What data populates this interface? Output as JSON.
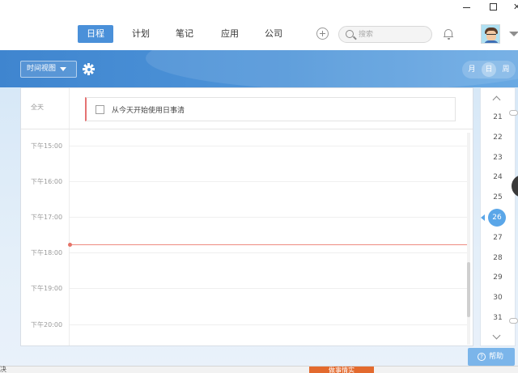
{
  "nav": {
    "tabs": [
      {
        "label": "日程",
        "active": true
      },
      {
        "label": "计划",
        "active": false
      },
      {
        "label": "笔记",
        "active": false
      },
      {
        "label": "应用",
        "active": false
      },
      {
        "label": "公司",
        "active": false
      }
    ]
  },
  "search": {
    "placeholder": "搜索"
  },
  "toolbar": {
    "view_label": "时间视图",
    "modes": [
      {
        "label": "月",
        "active": false
      },
      {
        "label": "日",
        "active": true
      },
      {
        "label": "周",
        "active": false
      }
    ]
  },
  "schedule": {
    "allday_label": "全天",
    "task_title": "从今天开始使用日事清",
    "hours": [
      "下午15:00",
      "下午16:00",
      "下午17:00",
      "下午18:00",
      "下午19:00",
      "下午20:00"
    ]
  },
  "datestrip": {
    "days": [
      "21",
      "22",
      "23",
      "24",
      "25",
      "26",
      "27",
      "28",
      "29",
      "30",
      "31"
    ],
    "selected": "26"
  },
  "help": {
    "label": "帮助",
    "q": "?"
  },
  "bottom": {
    "left_text": "决",
    "orange_text": "做事情实"
  },
  "colors": {
    "accent": "#4a90d9",
    "now_line": "#ee8a80",
    "selected_day": "#5aa6e8",
    "help_button": "#7bb5ea"
  }
}
